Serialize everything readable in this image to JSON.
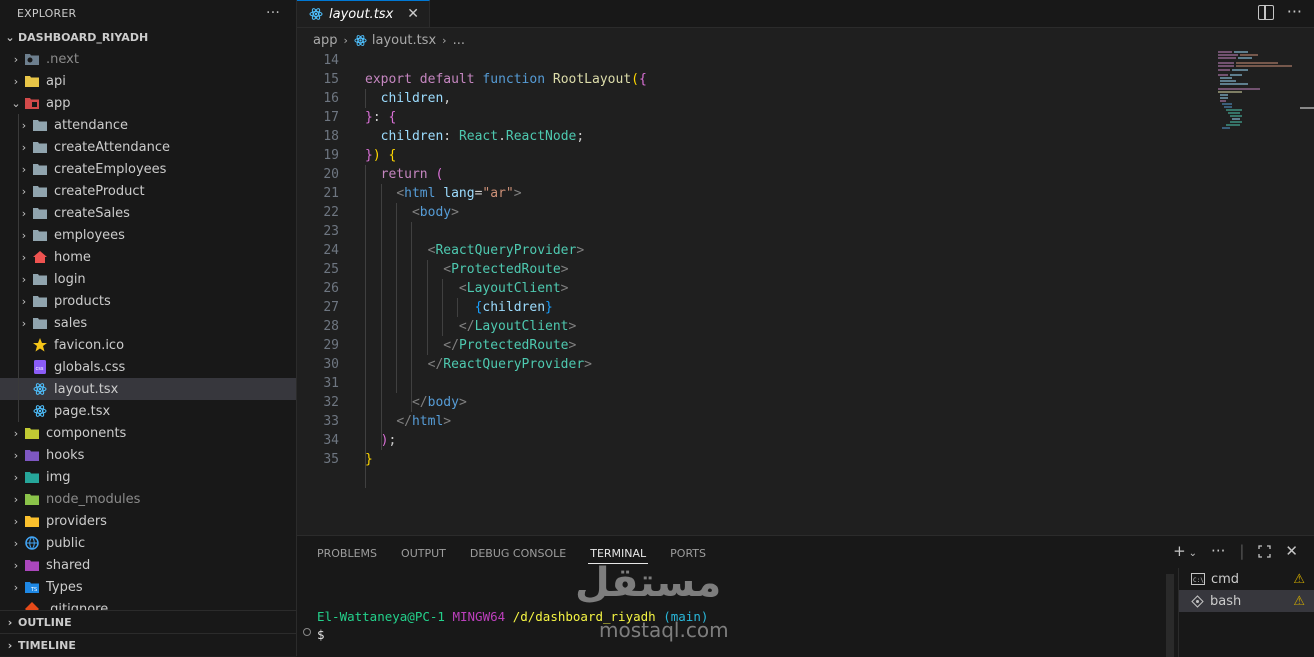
{
  "explorer": {
    "title": "EXPLORER",
    "root": "DASHBOARD_RIYADH",
    "items": [
      {
        "label": ".next",
        "kind": "folder",
        "depth": 1,
        "dim": true
      },
      {
        "label": "api",
        "kind": "folder",
        "depth": 1
      },
      {
        "label": "app",
        "kind": "folder-open",
        "depth": 1
      },
      {
        "label": "attendance",
        "kind": "folder",
        "depth": 2
      },
      {
        "label": "createAttendance",
        "kind": "folder",
        "depth": 2
      },
      {
        "label": "createEmployees",
        "kind": "folder",
        "depth": 2
      },
      {
        "label": "createProduct",
        "kind": "folder",
        "depth": 2
      },
      {
        "label": "createSales",
        "kind": "folder",
        "depth": 2
      },
      {
        "label": "employees",
        "kind": "folder",
        "depth": 2
      },
      {
        "label": "home",
        "kind": "folder",
        "depth": 2
      },
      {
        "label": "login",
        "kind": "folder",
        "depth": 2
      },
      {
        "label": "products",
        "kind": "folder",
        "depth": 2
      },
      {
        "label": "sales",
        "kind": "folder",
        "depth": 2
      },
      {
        "label": "favicon.ico",
        "kind": "file",
        "depth": 2
      },
      {
        "label": "globals.css",
        "kind": "file",
        "depth": 2
      },
      {
        "label": "layout.tsx",
        "kind": "file",
        "depth": 2,
        "selected": true
      },
      {
        "label": "page.tsx",
        "kind": "file",
        "depth": 2
      },
      {
        "label": "components",
        "kind": "folder",
        "depth": 1
      },
      {
        "label": "hooks",
        "kind": "folder",
        "depth": 1
      },
      {
        "label": "img",
        "kind": "folder",
        "depth": 1
      },
      {
        "label": "node_modules",
        "kind": "folder",
        "depth": 1,
        "dim": true
      },
      {
        "label": "providers",
        "kind": "folder",
        "depth": 1
      },
      {
        "label": "public",
        "kind": "folder",
        "depth": 1
      },
      {
        "label": "shared",
        "kind": "folder",
        "depth": 1
      },
      {
        "label": "Types",
        "kind": "folder",
        "depth": 1
      },
      {
        "label": ".gitignore",
        "kind": "file",
        "depth": 1
      }
    ],
    "outline": "OUTLINE",
    "timeline": "TIMELINE"
  },
  "editor": {
    "tab_label": "layout.tsx",
    "breadcrumb": [
      "app",
      "layout.tsx",
      "..."
    ],
    "line_numbers": [
      "14",
      "15",
      "16",
      "17",
      "18",
      "19",
      "20",
      "21",
      "22",
      "23",
      "24",
      "25",
      "26",
      "27",
      "28",
      "29",
      "30",
      "31",
      "32",
      "33",
      "34",
      "35"
    ]
  },
  "panel": {
    "tabs": [
      "PROBLEMS",
      "OUTPUT",
      "DEBUG CONSOLE",
      "TERMINAL",
      "PORTS"
    ],
    "active_tab": "TERMINAL",
    "prompt_user": "El-Wattaneya@PC-1",
    "prompt_env": "MINGW64",
    "prompt_path": "/d/dashboard_riyadh",
    "prompt_branch": "(main)",
    "prompt_symbol": "$",
    "terminals": [
      "cmd",
      "bash"
    ]
  },
  "watermark": {
    "arabic": "مستقل",
    "latin": "mostaql.com"
  },
  "colors": {
    "accent": "#0078d4",
    "background": "#1f1f1f",
    "sidebar": "#181818"
  }
}
